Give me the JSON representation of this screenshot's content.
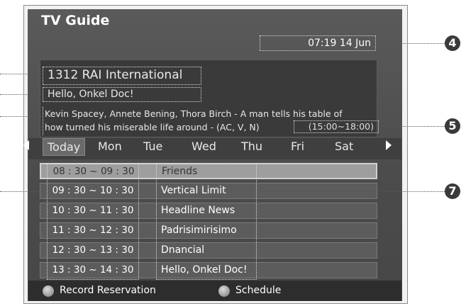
{
  "window": {
    "title": "TV Guide"
  },
  "datetime": "07:19 14 Jun",
  "info": {
    "channel": "1312 RAI International",
    "program": "Hello, Onkel Doc!",
    "description_line1": "Kevin Spacey, Annete Bening, Thora Birch - A man tells his table of",
    "description_line2": "how turned his miserable life around - (AC, V, N)",
    "timeslot": "(15:00~18:00)"
  },
  "days": [
    "Today",
    "Mon",
    "Tue",
    "Wed",
    "Thu",
    "Fri",
    "Sat"
  ],
  "schedule": [
    {
      "time": "08 : 30 ~ 09 : 30",
      "name": "Friends"
    },
    {
      "time": "09 : 30 ~ 10 : 30",
      "name": "Vertical Limit"
    },
    {
      "time": "10 : 30 ~ 11 : 30",
      "name": "Headline News"
    },
    {
      "time": "11 : 30 ~ 12 : 30",
      "name": "Padrisimirisimo"
    },
    {
      "time": "12 : 30 ~ 13 : 30",
      "name": "Dnancial"
    },
    {
      "time": "13 : 30 ~ 14 : 30",
      "name": "Hello, Onkel Doc!"
    }
  ],
  "footer": {
    "record_label": "Record Reservation",
    "schedule_label": "Schedule"
  },
  "callouts": [
    "4",
    "5",
    "7"
  ]
}
